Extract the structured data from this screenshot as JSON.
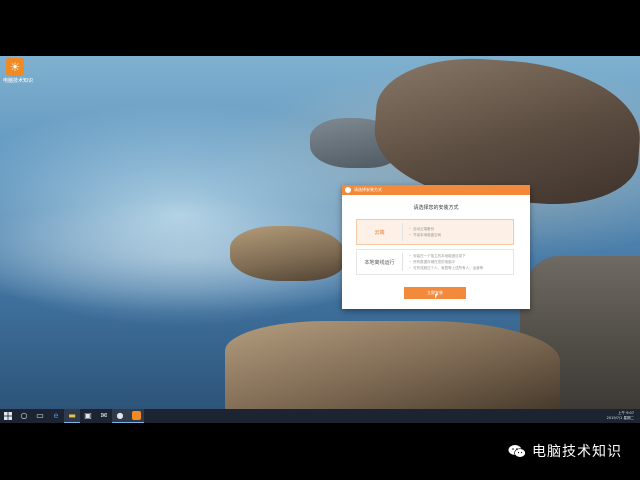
{
  "desktop": {
    "icons": [
      {
        "label": "电脑技术知识"
      }
    ]
  },
  "dialog": {
    "title": "请选择安装方式",
    "heading": "请选择您的安装方式",
    "options": [
      {
        "name": "云端",
        "selected": true,
        "bullets": [
          "自动云端备份",
          "节省本地磁盘空间"
        ]
      },
      {
        "name": "本地离线运行",
        "selected": false,
        "bullets": [
          "安装在一个独立的本地磁盘目录下",
          "所有数据存储在您的电脑中",
          "可完成超过个人、家庭等上述所有人、运营等"
        ]
      }
    ],
    "button_label": "立即安装"
  },
  "taskbar": {
    "items": [
      "start",
      "search",
      "task-view",
      "edge",
      "file-explorer",
      "store",
      "mail",
      "user",
      "app"
    ],
    "clock_time": "上午 9:07",
    "clock_date": "2019/7/1 星期二"
  },
  "watermark": {
    "text": "电脑技术知识"
  },
  "colors": {
    "accent": "#f2893b",
    "taskbar": "#1b2430"
  }
}
